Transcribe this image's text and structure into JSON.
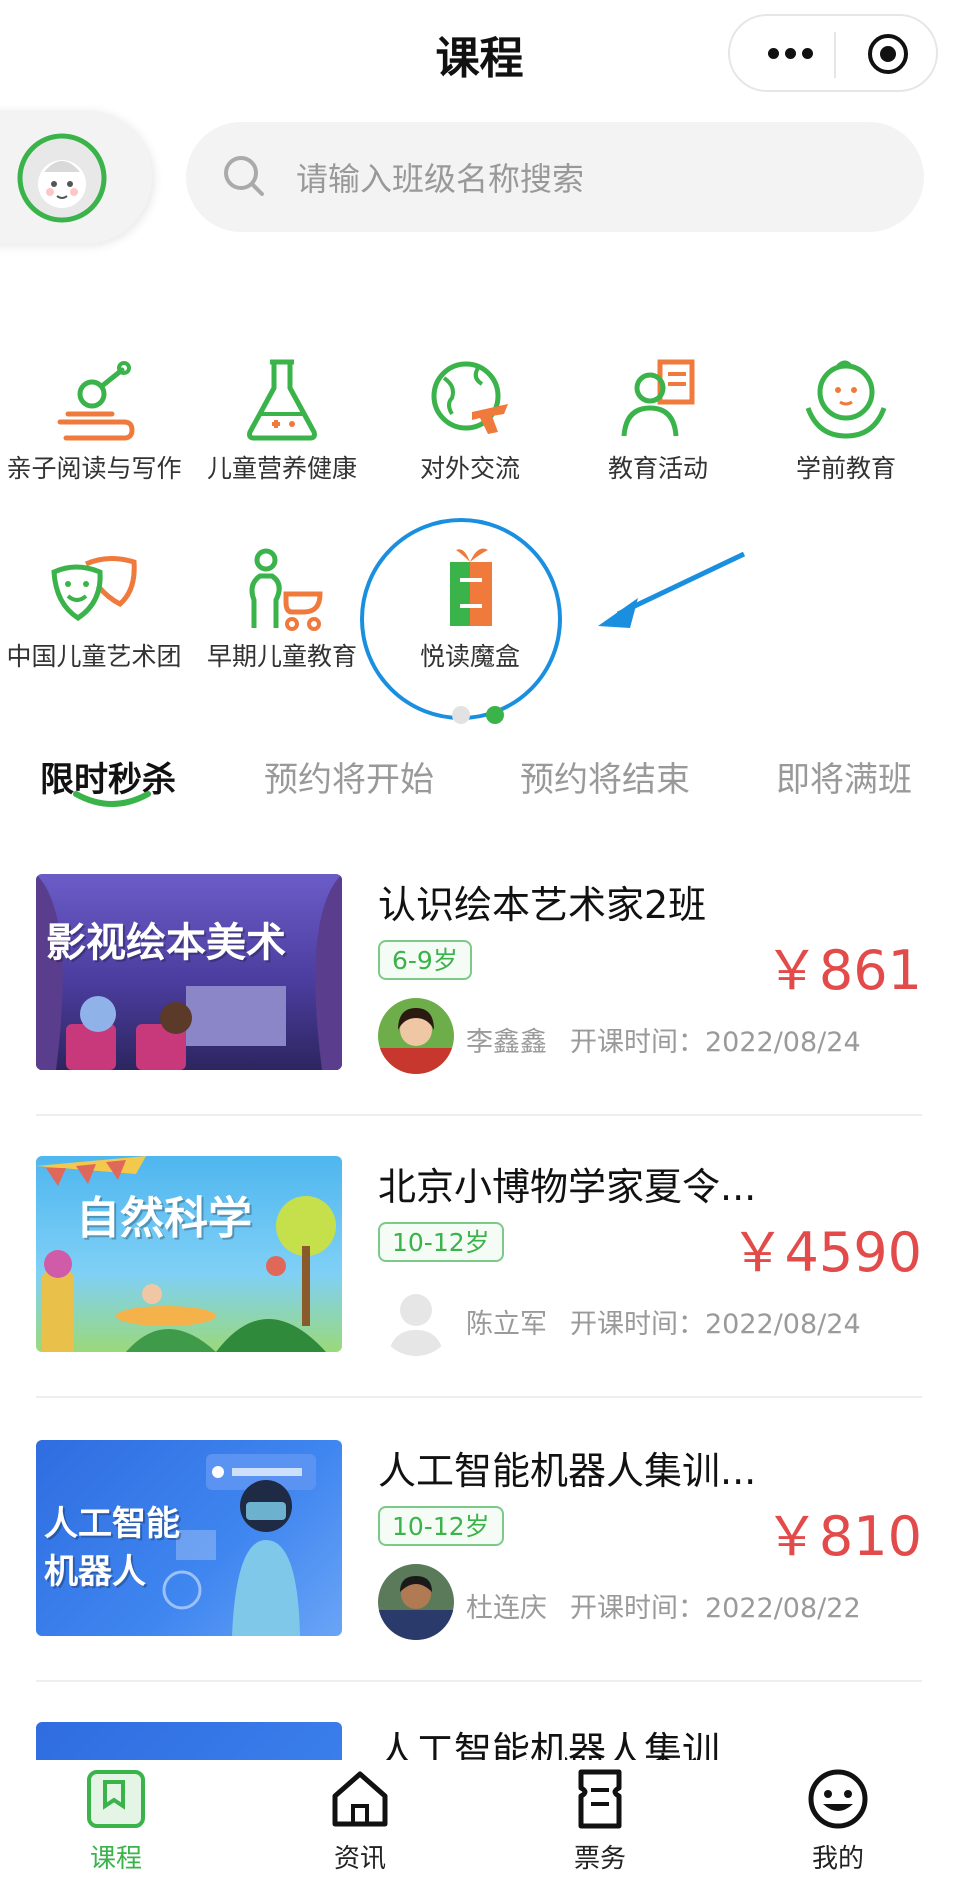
{
  "header": {
    "title": "课程"
  },
  "search": {
    "placeholder": "请输入班级名称搜索"
  },
  "categories": [
    {
      "label": "亲子阅读与写作",
      "icon": "reading-icon"
    },
    {
      "label": "儿童营养健康",
      "icon": "flask-icon"
    },
    {
      "label": "对外交流",
      "icon": "globe-plane-icon"
    },
    {
      "label": "教育活动",
      "icon": "teacher-board-icon"
    },
    {
      "label": "学前教育",
      "icon": "baby-face-icon"
    },
    {
      "label": "中国儿童艺术团",
      "icon": "theater-masks-icon"
    },
    {
      "label": "早期儿童教育",
      "icon": "mother-stroller-icon"
    },
    {
      "label": "悦读魔盒",
      "icon": "book-box-icon"
    }
  ],
  "tabs": [
    {
      "label": "限时秒杀"
    },
    {
      "label": "预约将开始"
    },
    {
      "label": "预约将结束"
    },
    {
      "label": "即将满班"
    }
  ],
  "courses": [
    {
      "title": "认识绘本艺术家2班",
      "age": "6-9岁",
      "price": "￥861",
      "teacher": "李鑫鑫",
      "open": "开课时间：2022/08/24",
      "thumb_text": "影视绘本美术"
    },
    {
      "title": "北京小博物学家夏令...",
      "age": "10-12岁",
      "price": "￥4590",
      "teacher": "陈立军",
      "open": "开课时间：2022/08/24",
      "thumb_text": "自然科学"
    },
    {
      "title": "人工智能机器人集训...",
      "age": "10-12岁",
      "price": "￥810",
      "teacher": "杜连庆",
      "open": "开课时间：2022/08/22",
      "thumb_text_1": "人工智能",
      "thumb_text_2": "机器人"
    },
    {
      "title": "人工智能机器人集训"
    }
  ],
  "nav": [
    {
      "label": "课程"
    },
    {
      "label": "资讯"
    },
    {
      "label": "票务"
    },
    {
      "label": "我的"
    }
  ],
  "colors": {
    "accent": "#3ab34a",
    "price": "#e34b4b",
    "highlight": "#1a8fe0",
    "icon_orange": "#f07a3c"
  }
}
